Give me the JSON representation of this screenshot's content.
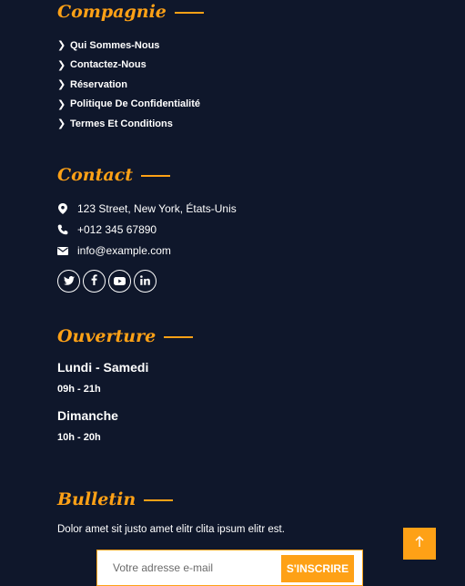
{
  "colors": {
    "background": "#0f172b",
    "accent": "#fea116",
    "text": "#ffffff"
  },
  "company": {
    "heading": "Compagnie",
    "links": [
      "Qui Sommes-Nous",
      "Contactez-Nous",
      "Réservation",
      "Politique De Confidentialité",
      "Termes Et Conditions"
    ]
  },
  "contact": {
    "heading": "Contact",
    "address": "123 Street, New York, États-Unis",
    "phone": "+012 345 67890",
    "email": "info@example.com",
    "socials": [
      "twitter-icon",
      "facebook-icon",
      "youtube-icon",
      "linkedin-icon"
    ]
  },
  "opening": {
    "heading": "Ouverture",
    "schedule": [
      {
        "days": "Lundi - Samedi",
        "hours": "09h - 21h"
      },
      {
        "days": "Dimanche",
        "hours": "10h - 20h"
      }
    ]
  },
  "newsletter": {
    "heading": "Bulletin",
    "text": "Dolor amet sit justo amet elitr clita ipsum elitr est.",
    "placeholder": "Votre adresse e-mail",
    "button_label": "S'INSCRIRE"
  },
  "back_to_top": {
    "icon": "arrow-up-icon"
  }
}
